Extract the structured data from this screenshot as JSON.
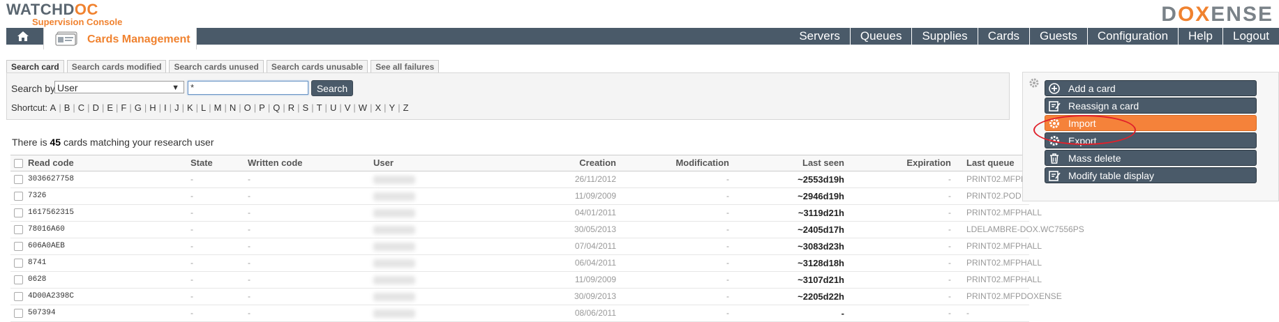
{
  "header": {
    "brand_left": "WATCHDOC",
    "brand_left_main": "WATCHD",
    "brand_left_accent": "OC",
    "subtitle": "Supervision Console",
    "brand_right_a": "D",
    "brand_right_x": "OX",
    "brand_right_b": "ENSE",
    "module_title": "Cards Management"
  },
  "menu": [
    "Servers",
    "Queues",
    "Supplies",
    "Cards",
    "Guests",
    "Configuration",
    "Help",
    "Logout"
  ],
  "tabs": [
    "Search card",
    "Search cards modified",
    "Search cards unused",
    "Search cards unusable",
    "See all failures"
  ],
  "search": {
    "label": "Search by",
    "field_value": "User",
    "input_value": "*",
    "button": "Search",
    "shortcut_label": "Shortcut:",
    "letters": [
      "A",
      "B",
      "C",
      "D",
      "E",
      "F",
      "G",
      "H",
      "I",
      "J",
      "K",
      "L",
      "M",
      "N",
      "O",
      "P",
      "Q",
      "R",
      "S",
      "T",
      "U",
      "V",
      "W",
      "X",
      "Y",
      "Z"
    ]
  },
  "result": {
    "prefix": "There is",
    "count": "45",
    "suffix": "cards matching your research user"
  },
  "table": {
    "headers": {
      "read_code": "Read code",
      "state": "State",
      "written_code": "Written code",
      "user": "User",
      "creation": "Creation",
      "modification": "Modification",
      "last_seen": "Last seen",
      "expiration": "Expiration",
      "last_queue": "Last queue"
    },
    "rows": [
      {
        "read": "3036627758",
        "state": "-",
        "written": "-",
        "creation": "26/11/2012",
        "mod": "-",
        "last": "~2553d19h",
        "exp": "-",
        "queue": "PRINT02.MFPH"
      },
      {
        "read": "7326",
        "state": "-",
        "written": "-",
        "creation": "11/09/2009",
        "mod": "-",
        "last": "~2946d19h",
        "exp": "-",
        "queue": "PRINT02.POD"
      },
      {
        "read": "1617562315",
        "state": "-",
        "written": "-",
        "creation": "04/01/2011",
        "mod": "-",
        "last": "~3119d21h",
        "exp": "-",
        "queue": "PRINT02.MFPHALL"
      },
      {
        "read": "78016A60",
        "state": "-",
        "written": "-",
        "creation": "30/05/2013",
        "mod": "-",
        "last": "~2405d17h",
        "exp": "-",
        "queue": "LDELAMBRE-DOX.WC7556PS"
      },
      {
        "read": "606A0AEB",
        "state": "-",
        "written": "-",
        "creation": "07/04/2011",
        "mod": "-",
        "last": "~3083d23h",
        "exp": "-",
        "queue": "PRINT02.MFPHALL"
      },
      {
        "read": "8741",
        "state": "-",
        "written": "-",
        "creation": "06/04/2011",
        "mod": "-",
        "last": "~3128d18h",
        "exp": "-",
        "queue": "PRINT02.MFPHALL"
      },
      {
        "read": "0628",
        "state": "-",
        "written": "-",
        "creation": "11/09/2009",
        "mod": "-",
        "last": "~3107d21h",
        "exp": "-",
        "queue": "PRINT02.MFPHALL"
      },
      {
        "read": "4D00A2398C",
        "state": "-",
        "written": "-",
        "creation": "30/09/2013",
        "mod": "-",
        "last": "~2205d22h",
        "exp": "-",
        "queue": "PRINT02.MFPDOXENSE"
      },
      {
        "read": "507394",
        "state": "-",
        "written": "-",
        "creation": "08/06/2011",
        "mod": "-",
        "last": "-",
        "exp": "-",
        "queue": "-"
      }
    ]
  },
  "actions": [
    {
      "label": "Add a card",
      "icon": "plus-circle-icon"
    },
    {
      "label": "Reassign a card",
      "icon": "edit-icon"
    },
    {
      "label": "Import",
      "icon": "gear-icon"
    },
    {
      "label": "Export",
      "icon": "gear-icon"
    },
    {
      "label": "Mass delete",
      "icon": "trash-icon"
    },
    {
      "label": "Modify table display",
      "icon": "edit-icon"
    }
  ],
  "colors": {
    "accent": "#f0822f",
    "nav": "#4a5a69",
    "highlight": "#f5823a",
    "annotation": "#e0212b"
  }
}
